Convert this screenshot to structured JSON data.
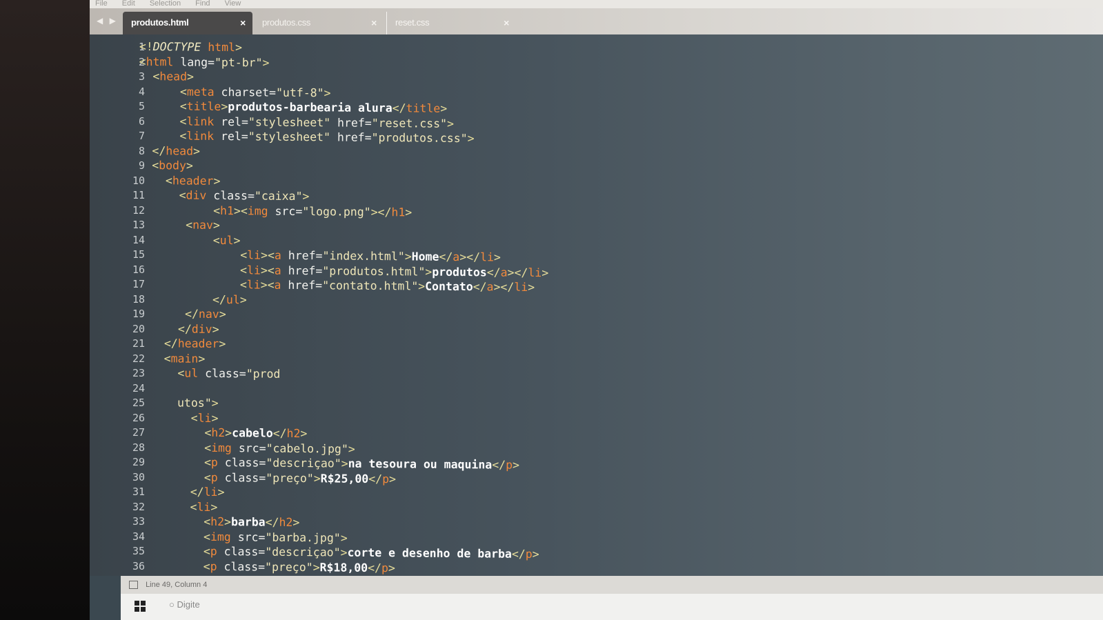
{
  "menu": [
    "File",
    "Edit",
    "Selection",
    "Find",
    "View"
  ],
  "tabs": [
    {
      "label": "produtos.html",
      "active": true,
      "close": "×"
    },
    {
      "label": "produtos.css",
      "active": false,
      "close": "×"
    },
    {
      "label": "reset.css",
      "active": false,
      "close": "×"
    }
  ],
  "nav_arrows": "◀ ▶",
  "status": {
    "position": "Line 49, Column 4"
  },
  "taskbar": {
    "search_placeholder": "Digite"
  },
  "colors": {
    "background": "#3b4850",
    "tag": "#f28a3c",
    "bracket": "#e6dd9a",
    "string": "#efe6b8",
    "text": "#ffffff"
  },
  "code": [
    [
      [
        "br",
        "<!"
      ],
      [
        "doc",
        "DOCTYPE "
      ],
      [
        "tag",
        "html"
      ],
      [
        "br",
        ">"
      ]
    ],
    [
      [
        "br",
        "<"
      ],
      [
        "tag",
        "html "
      ],
      [
        "attr",
        "lang"
      ],
      [
        "eq",
        "="
      ],
      [
        "str",
        "\"pt-br\""
      ],
      [
        "br",
        ">"
      ]
    ],
    [
      [
        "ws",
        "  "
      ],
      [
        "br",
        "<"
      ],
      [
        "tag",
        "head"
      ],
      [
        "br",
        ">"
      ]
    ],
    [
      [
        "ws",
        "      "
      ],
      [
        "br",
        "<"
      ],
      [
        "tag",
        "meta "
      ],
      [
        "attr",
        "charset"
      ],
      [
        "eq",
        "="
      ],
      [
        "str",
        "\"utf-8\""
      ],
      [
        "br",
        ">"
      ]
    ],
    [
      [
        "ws",
        "      "
      ],
      [
        "br",
        "<"
      ],
      [
        "tag",
        "title"
      ],
      [
        "br",
        ">"
      ],
      [
        "text",
        "produtos-barbearia alura"
      ],
      [
        "br",
        "</"
      ],
      [
        "tag",
        "title"
      ],
      [
        "br",
        ">"
      ]
    ],
    [
      [
        "ws",
        "      "
      ],
      [
        "br",
        "<"
      ],
      [
        "tag",
        "link "
      ],
      [
        "attr",
        "rel"
      ],
      [
        "eq",
        "="
      ],
      [
        "str",
        "\"stylesheet\" "
      ],
      [
        "attr",
        "href"
      ],
      [
        "eq",
        "="
      ],
      [
        "str",
        "\"reset.css\""
      ],
      [
        "br",
        ">"
      ]
    ],
    [
      [
        "ws",
        "      "
      ],
      [
        "br",
        "<"
      ],
      [
        "tag",
        "link "
      ],
      [
        "attr",
        "rel"
      ],
      [
        "eq",
        "="
      ],
      [
        "str",
        "\"stylesheet\" "
      ],
      [
        "attr",
        "href"
      ],
      [
        "eq",
        "="
      ],
      [
        "str",
        "\"produtos.css\""
      ],
      [
        "br",
        ">"
      ]
    ],
    [
      [
        "ws",
        "  "
      ],
      [
        "br",
        "</"
      ],
      [
        "tag",
        "head"
      ],
      [
        "br",
        ">"
      ]
    ],
    [
      [
        "ws",
        "  "
      ],
      [
        "br",
        "<"
      ],
      [
        "tag",
        "body"
      ],
      [
        "br",
        ">"
      ]
    ],
    [
      [
        "ws",
        "    "
      ],
      [
        "br",
        "<"
      ],
      [
        "tag",
        "header"
      ],
      [
        "br",
        ">"
      ]
    ],
    [
      [
        "ws",
        "      "
      ],
      [
        "br",
        "<"
      ],
      [
        "tag",
        "div "
      ],
      [
        "attr",
        "class"
      ],
      [
        "eq",
        "="
      ],
      [
        "str",
        "\"caixa\""
      ],
      [
        "br",
        ">"
      ]
    ],
    [
      [
        "ws",
        "           "
      ],
      [
        "br",
        "<"
      ],
      [
        "tag",
        "h1"
      ],
      [
        "br",
        "><"
      ],
      [
        "tag",
        "img "
      ],
      [
        "attr",
        "src"
      ],
      [
        "eq",
        "="
      ],
      [
        "str",
        "\"logo.png\""
      ],
      [
        "br",
        "></"
      ],
      [
        "tag",
        "h1"
      ],
      [
        "br",
        ">"
      ]
    ],
    [
      [
        "ws",
        "       "
      ],
      [
        "br",
        "<"
      ],
      [
        "tag",
        "nav"
      ],
      [
        "br",
        ">"
      ]
    ],
    [
      [
        "ws",
        "           "
      ],
      [
        "br",
        "<"
      ],
      [
        "tag",
        "ul"
      ],
      [
        "br",
        ">"
      ]
    ],
    [
      [
        "ws",
        "               "
      ],
      [
        "br",
        "<"
      ],
      [
        "tag",
        "li"
      ],
      [
        "br",
        "><"
      ],
      [
        "tag",
        "a "
      ],
      [
        "attr",
        "href"
      ],
      [
        "eq",
        "="
      ],
      [
        "str",
        "\"index.html\""
      ],
      [
        "br",
        ">"
      ],
      [
        "text",
        "Home"
      ],
      [
        "br",
        "</"
      ],
      [
        "tag",
        "a"
      ],
      [
        "br",
        "></"
      ],
      [
        "tag",
        "li"
      ],
      [
        "br",
        ">"
      ]
    ],
    [
      [
        "ws",
        "               "
      ],
      [
        "br",
        "<"
      ],
      [
        "tag",
        "li"
      ],
      [
        "br",
        "><"
      ],
      [
        "tag",
        "a "
      ],
      [
        "attr",
        "href"
      ],
      [
        "eq",
        "="
      ],
      [
        "str",
        "\"produtos.html\""
      ],
      [
        "br",
        ">"
      ],
      [
        "text",
        "produtos"
      ],
      [
        "br",
        "</"
      ],
      [
        "tag",
        "a"
      ],
      [
        "br",
        "></"
      ],
      [
        "tag",
        "li"
      ],
      [
        "br",
        ">"
      ]
    ],
    [
      [
        "ws",
        "               "
      ],
      [
        "br",
        "<"
      ],
      [
        "tag",
        "li"
      ],
      [
        "br",
        "><"
      ],
      [
        "tag",
        "a "
      ],
      [
        "attr",
        "href"
      ],
      [
        "eq",
        "="
      ],
      [
        "str",
        "\"contato.html\""
      ],
      [
        "br",
        ">"
      ],
      [
        "text",
        "Contato"
      ],
      [
        "br",
        "</"
      ],
      [
        "tag",
        "a"
      ],
      [
        "br",
        "></"
      ],
      [
        "tag",
        "li"
      ],
      [
        "br",
        ">"
      ]
    ],
    [
      [
        "ws",
        "           "
      ],
      [
        "br",
        "</"
      ],
      [
        "tag",
        "ul"
      ],
      [
        "br",
        ">"
      ]
    ],
    [
      [
        "ws",
        "       "
      ],
      [
        "br",
        "</"
      ],
      [
        "tag",
        "nav"
      ],
      [
        "br",
        ">"
      ]
    ],
    [
      [
        "ws",
        "      "
      ],
      [
        "br",
        "</"
      ],
      [
        "tag",
        "div"
      ],
      [
        "br",
        ">"
      ]
    ],
    [
      [
        "ws",
        "    "
      ],
      [
        "br",
        "</"
      ],
      [
        "tag",
        "header"
      ],
      [
        "br",
        ">"
      ]
    ],
    [
      [
        "ws",
        "    "
      ],
      [
        "br",
        "<"
      ],
      [
        "tag",
        "main"
      ],
      [
        "br",
        ">"
      ]
    ],
    [
      [
        "ws",
        "      "
      ],
      [
        "br",
        "<"
      ],
      [
        "tag",
        "ul "
      ],
      [
        "attr",
        "class"
      ],
      [
        "eq",
        "="
      ],
      [
        "str",
        "\"prod"
      ]
    ],
    [],
    [
      [
        "ws",
        "      "
      ],
      [
        "str",
        "utos\""
      ],
      [
        "br",
        ">"
      ]
    ],
    [
      [
        "ws",
        "        "
      ],
      [
        "br",
        "<"
      ],
      [
        "tag",
        "li"
      ],
      [
        "br",
        ">"
      ]
    ],
    [
      [
        "ws",
        "          "
      ],
      [
        "br",
        "<"
      ],
      [
        "tag",
        "h2"
      ],
      [
        "br",
        ">"
      ],
      [
        "text",
        "cabelo"
      ],
      [
        "br",
        "</"
      ],
      [
        "tag",
        "h2"
      ],
      [
        "br",
        ">"
      ]
    ],
    [
      [
        "ws",
        "          "
      ],
      [
        "br",
        "<"
      ],
      [
        "tag",
        "img "
      ],
      [
        "attr",
        "src"
      ],
      [
        "eq",
        "="
      ],
      [
        "str",
        "\"cabelo.jpg\""
      ],
      [
        "br",
        ">"
      ]
    ],
    [
      [
        "ws",
        "          "
      ],
      [
        "br",
        "<"
      ],
      [
        "tag",
        "p "
      ],
      [
        "attr",
        "class"
      ],
      [
        "eq",
        "="
      ],
      [
        "str",
        "\"descriçao\""
      ],
      [
        "br",
        ">"
      ],
      [
        "text",
        "na tesoura ou maquina"
      ],
      [
        "br",
        "</"
      ],
      [
        "tag",
        "p"
      ],
      [
        "br",
        ">"
      ]
    ],
    [
      [
        "ws",
        "          "
      ],
      [
        "br",
        "<"
      ],
      [
        "tag",
        "p "
      ],
      [
        "attr",
        "class"
      ],
      [
        "eq",
        "="
      ],
      [
        "str",
        "\"preço\""
      ],
      [
        "br",
        ">"
      ],
      [
        "text",
        "R$25,00"
      ],
      [
        "br",
        "</"
      ],
      [
        "tag",
        "p"
      ],
      [
        "br",
        ">"
      ]
    ],
    [
      [
        "ws",
        "        "
      ],
      [
        "br",
        "</"
      ],
      [
        "tag",
        "li"
      ],
      [
        "br",
        ">"
      ]
    ],
    [
      [
        "ws",
        "        "
      ],
      [
        "br",
        "<"
      ],
      [
        "tag",
        "li"
      ],
      [
        "br",
        ">"
      ]
    ],
    [
      [
        "ws",
        "          "
      ],
      [
        "br",
        "<"
      ],
      [
        "tag",
        "h2"
      ],
      [
        "br",
        ">"
      ],
      [
        "text",
        "barba"
      ],
      [
        "br",
        "</"
      ],
      [
        "tag",
        "h2"
      ],
      [
        "br",
        ">"
      ]
    ],
    [
      [
        "ws",
        "          "
      ],
      [
        "br",
        "<"
      ],
      [
        "tag",
        "img "
      ],
      [
        "attr",
        "src"
      ],
      [
        "eq",
        "="
      ],
      [
        "str",
        "\"barba.jpg\""
      ],
      [
        "br",
        ">"
      ]
    ],
    [
      [
        "ws",
        "          "
      ],
      [
        "br",
        "<"
      ],
      [
        "tag",
        "p "
      ],
      [
        "attr",
        "class"
      ],
      [
        "eq",
        "="
      ],
      [
        "str",
        "\"descriçao\""
      ],
      [
        "br",
        ">"
      ],
      [
        "text",
        "corte e desenho de barba"
      ],
      [
        "br",
        "</"
      ],
      [
        "tag",
        "p"
      ],
      [
        "br",
        ">"
      ]
    ],
    [
      [
        "ws",
        "          "
      ],
      [
        "br",
        "<"
      ],
      [
        "tag",
        "p "
      ],
      [
        "attr",
        "class"
      ],
      [
        "eq",
        "="
      ],
      [
        "str",
        "\"preço\""
      ],
      [
        "br",
        ">"
      ],
      [
        "text",
        "R$18,00"
      ],
      [
        "br",
        "</"
      ],
      [
        "tag",
        "p"
      ],
      [
        "br",
        ">"
      ]
    ]
  ]
}
